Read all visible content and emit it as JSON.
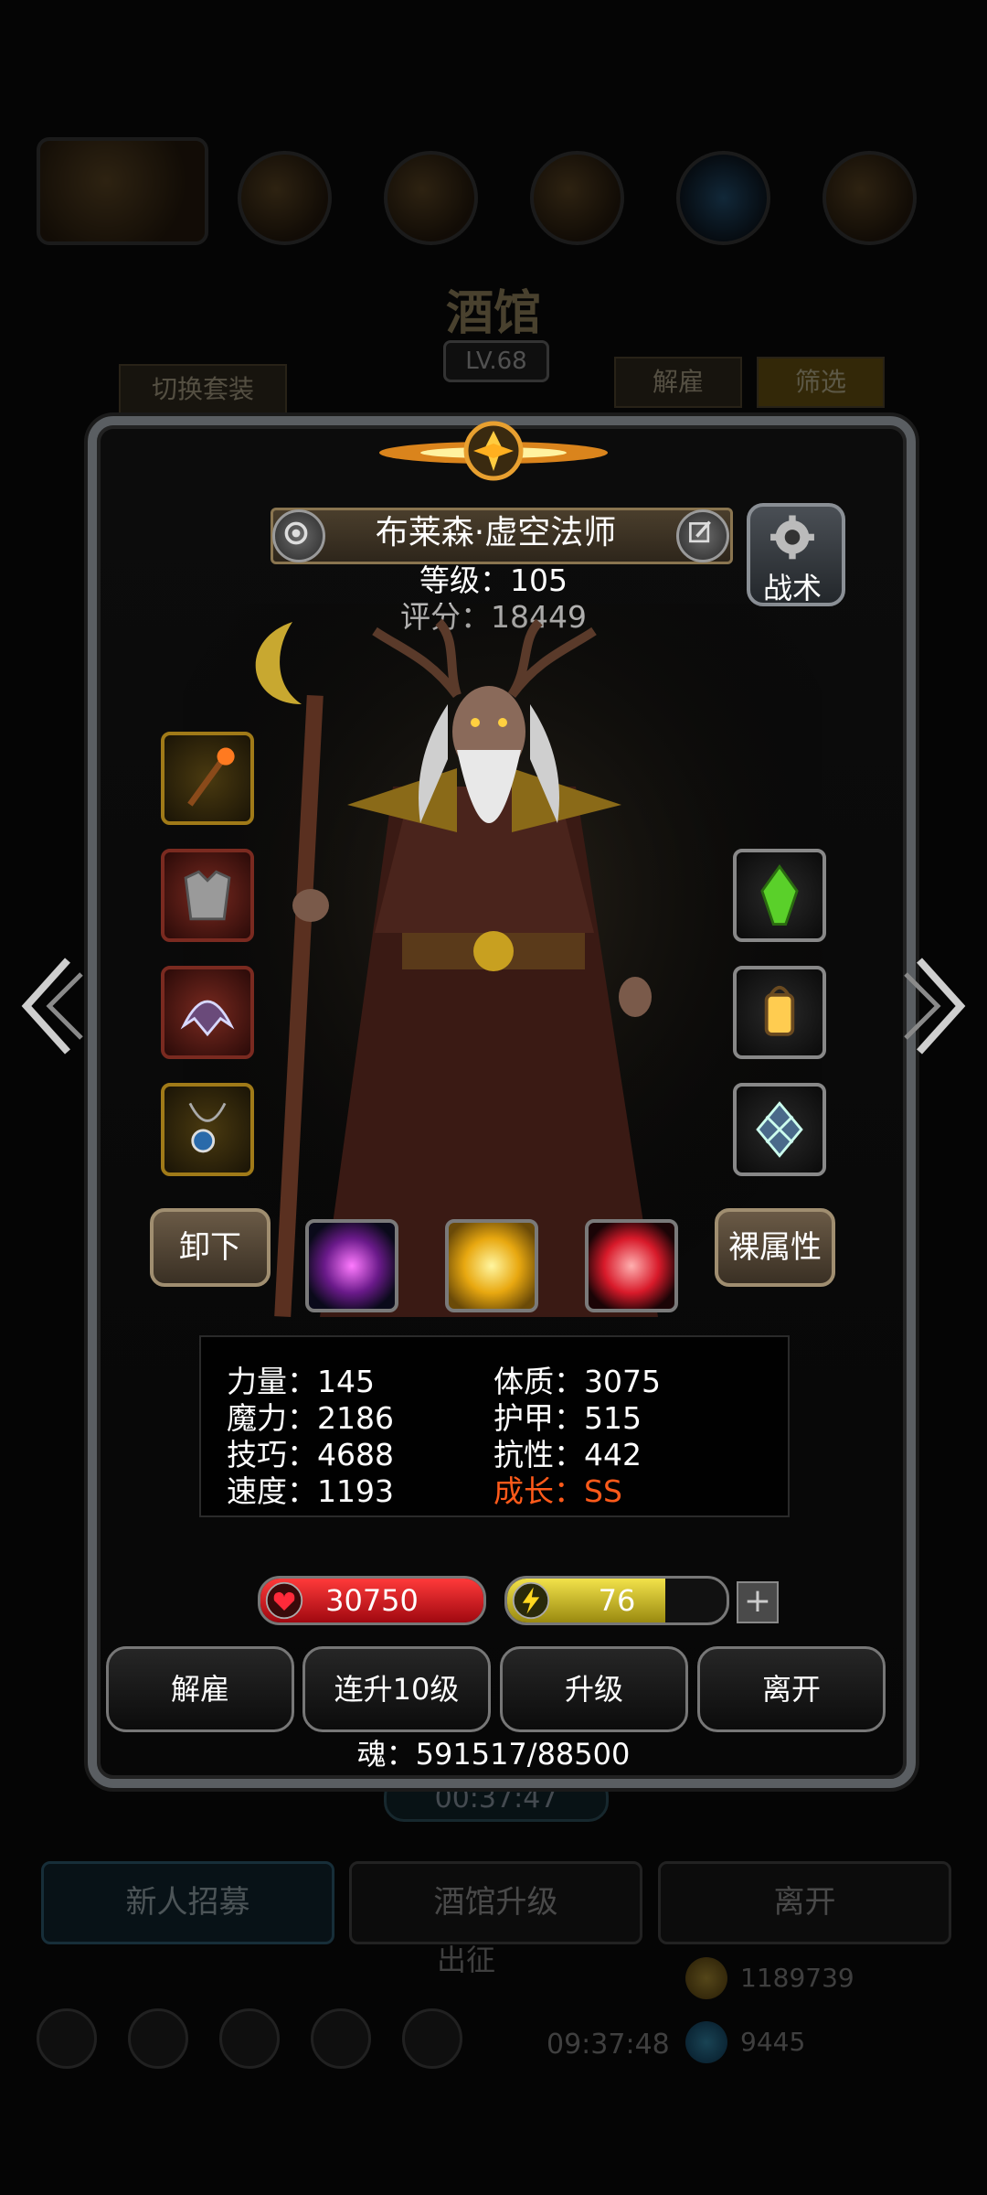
{
  "background": {
    "title": "酒馆",
    "level": "LV.68",
    "switch_outfit": "切换套装",
    "dismiss": "解雇",
    "filter": "筛选",
    "timer": "00:37:47",
    "bottom_buttons": [
      "新人招募",
      "酒馆升级",
      "离开"
    ],
    "deploy": "出征",
    "gold": "1189739",
    "gem": "9445",
    "clock": "09:37:48"
  },
  "hero": {
    "name": "布莱森·虚空法师",
    "level_line": "等级：105",
    "score_line": "评分：18449",
    "tactics_label": "战术"
  },
  "buttons": {
    "unequip": "卸下",
    "base_attrs": "裸属性"
  },
  "attributes": {
    "strength": "力量：145",
    "magic": "魔力：2186",
    "skill": "技巧：4688",
    "speed": "速度：1193",
    "constitution": "体质：3075",
    "armor": "护甲：515",
    "resistance": "抗性：442",
    "growth": "成长：SS"
  },
  "bars": {
    "hp": "30750",
    "energy": "76",
    "energy_fraction": 0.72,
    "plus": "+"
  },
  "actions": [
    "解雇",
    "连升10级",
    "升级",
    "离开"
  ],
  "soul": "魂：591517/88500",
  "colors": {
    "hp_red": "#d0141e",
    "energy_yellow": "#d6c21a",
    "growth_orange": "#ff5a1a",
    "frame_gold": "#a07a18"
  },
  "icons": {
    "left_slots": [
      "staff-icon",
      "armor-icon",
      "helmet-icon",
      "amulet-icon"
    ],
    "right_slots": [
      "green-crystal-icon",
      "lantern-icon",
      "emblem-icon"
    ],
    "orbs": [
      "purple-orb-icon",
      "gold-orb-icon",
      "red-orb-icon"
    ]
  }
}
